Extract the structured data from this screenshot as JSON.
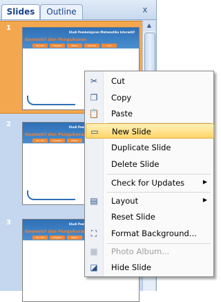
{
  "panel": {
    "tabs": [
      {
        "label": "Slides",
        "active": true
      },
      {
        "label": "Outline",
        "active": false
      }
    ],
    "close_glyph": "x"
  },
  "slides": [
    {
      "number": "1",
      "selected": true,
      "subtitle": "Studi Pembelajaran Matematika Interaktif",
      "title": "Geometri dan Pengukuran",
      "menu": [
        "SK / KD",
        "Indikator",
        "Materi",
        "Evaluasi",
        "Kuis"
      ]
    },
    {
      "number": "2",
      "selected": false,
      "subtitle": "Studi Pembelajaran Matematika Interaktif",
      "title": "Geometri dan Pengukuran",
      "menu": [
        "SK / KD",
        "Indikator",
        "Materi"
      ]
    },
    {
      "number": "3",
      "selected": false,
      "subtitle": "Studi Pembelajaran Matematika Interaktif",
      "title": "Geometri dan Pengukuran",
      "menu": [
        "SK / KD",
        "Indikator",
        "Materi"
      ]
    }
  ],
  "context_menu": {
    "items": [
      {
        "name": "cut",
        "label": "Cut",
        "icon": "scissors-icon",
        "glyph": "✂"
      },
      {
        "name": "copy",
        "label": "Copy",
        "icon": "copy-icon",
        "glyph": "❐"
      },
      {
        "name": "paste",
        "label": "Paste",
        "icon": "paste-icon",
        "glyph": "📋"
      },
      {
        "name": "new-slide",
        "label": "New Slide",
        "icon": "new-slide-icon",
        "glyph": "▭",
        "highlighted": true
      },
      {
        "name": "duplicate-slide",
        "label": "Duplicate Slide"
      },
      {
        "name": "delete-slide",
        "label": "Delete Slide"
      },
      {
        "name": "check-for-updates",
        "label": "Check for Updates",
        "submenu": true
      },
      {
        "name": "layout",
        "label": "Layout",
        "icon": "layout-icon",
        "glyph": "▤",
        "submenu": true
      },
      {
        "name": "reset-slide",
        "label": "Reset Slide"
      },
      {
        "name": "format-background",
        "label": "Format Background...",
        "icon": "paint-bucket-icon",
        "glyph": "⛶"
      },
      {
        "name": "photo-album",
        "label": "Photo Album...",
        "icon": "photo-album-icon",
        "glyph": "▦",
        "disabled": true
      },
      {
        "name": "hide-slide",
        "label": "Hide Slide",
        "icon": "hide-slide-icon",
        "glyph": "◪"
      }
    ],
    "submenu_glyph": "▶"
  },
  "colors": {
    "selection": "#f3a850",
    "highlight": "#ffd66b",
    "panel_bg": "#c5d7ee"
  }
}
